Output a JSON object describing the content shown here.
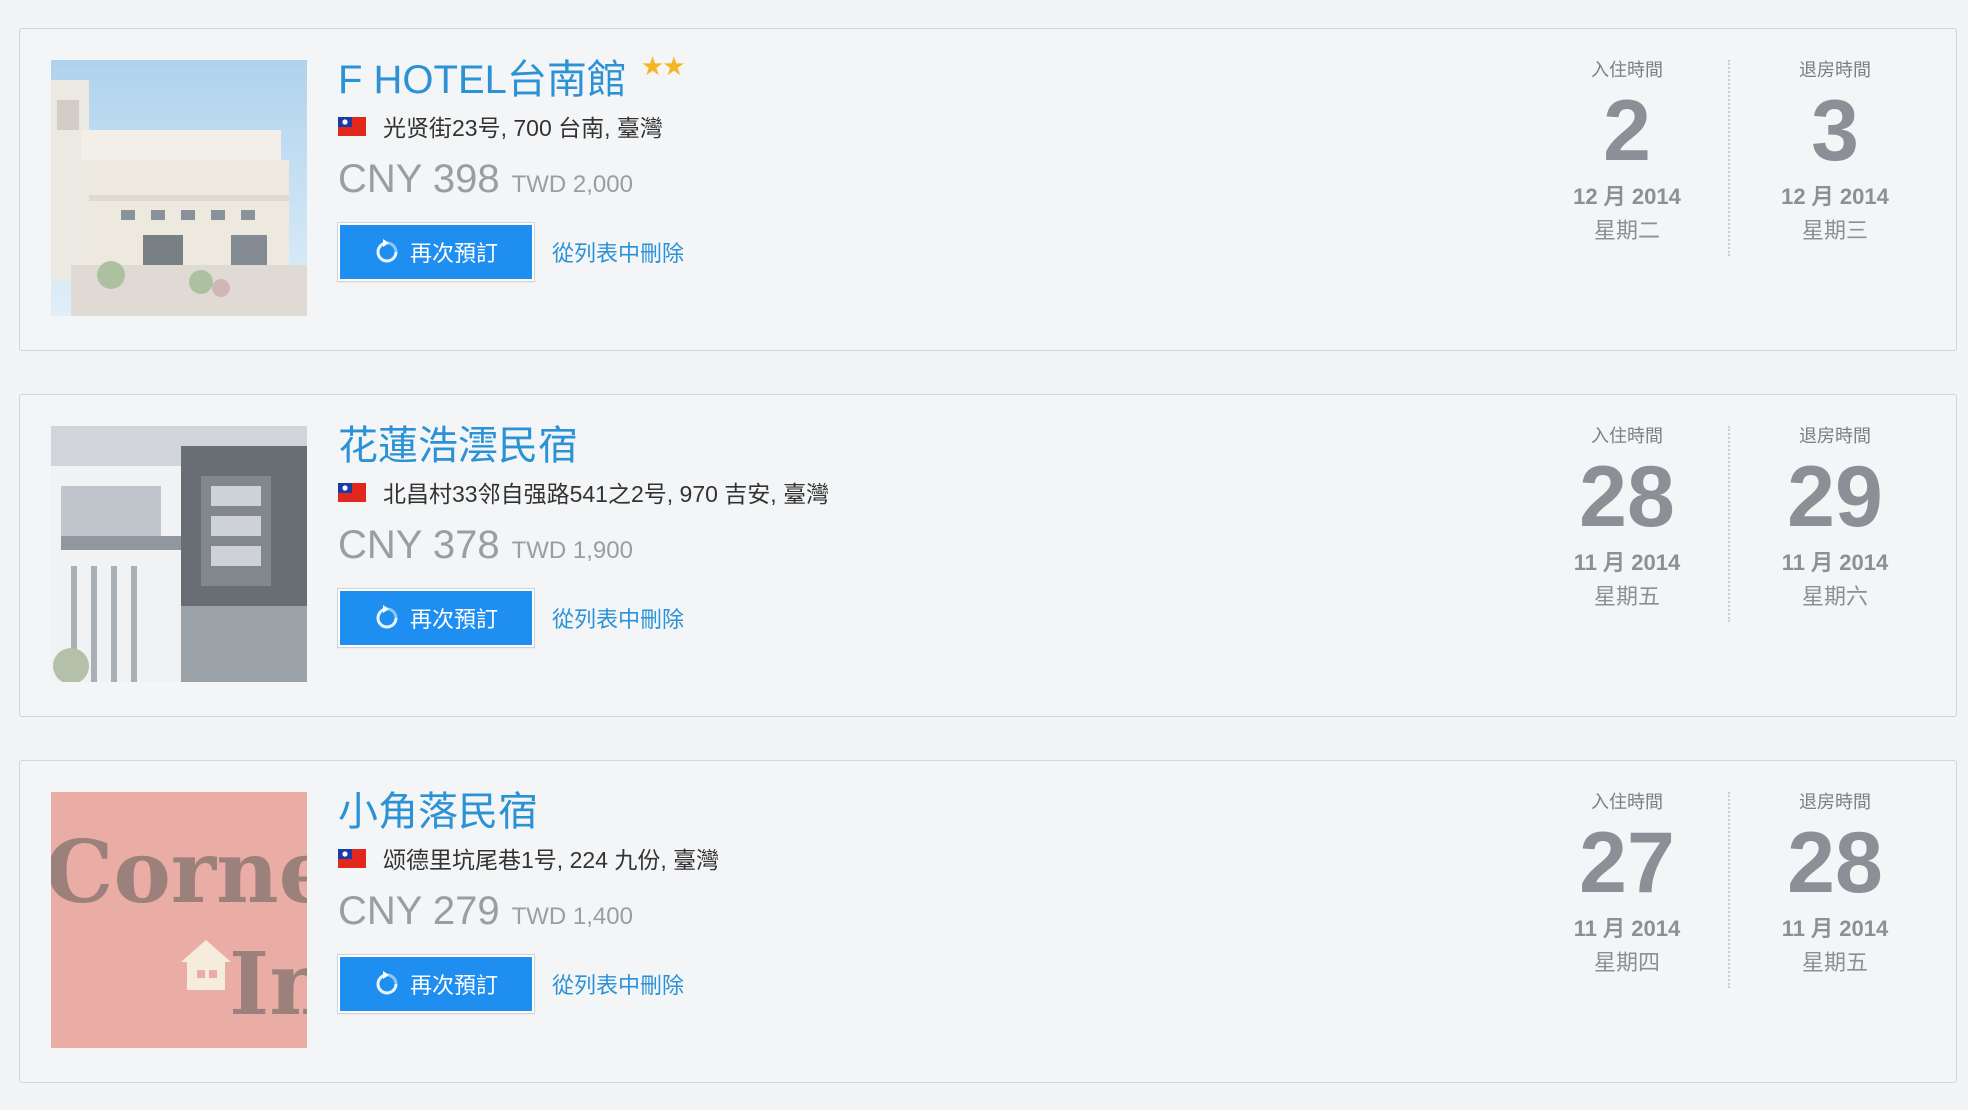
{
  "bookings": [
    {
      "name": "F HOTEL台南館",
      "stars": "★★",
      "address": "光贤街23号, 700 台南, 臺灣",
      "price_main": "CNY 398",
      "price_sub": "TWD 2,000",
      "rebook_label": "再次預訂",
      "remove_label": "從列表中刪除",
      "checkin": {
        "label": "入住時間",
        "day": "2",
        "month": "12 月 2014",
        "weekday": "星期二"
      },
      "checkout": {
        "label": "退房時間",
        "day": "3",
        "month": "12 月 2014",
        "weekday": "星期三"
      }
    },
    {
      "name": "花蓮浩澐民宿",
      "stars": "",
      "address": "北昌村33邻自强路541之2号, 970 吉安, 臺灣",
      "price_main": "CNY 378",
      "price_sub": "TWD 1,900",
      "rebook_label": "再次預訂",
      "remove_label": "從列表中刪除",
      "checkin": {
        "label": "入住時間",
        "day": "28",
        "month": "11 月 2014",
        "weekday": "星期五"
      },
      "checkout": {
        "label": "退房時間",
        "day": "29",
        "month": "11 月 2014",
        "weekday": "星期六"
      }
    },
    {
      "name": "小角落民宿",
      "stars": "",
      "address": "颂德里坑尾巷1号, 224 九份, 臺灣",
      "price_main": "CNY 279",
      "price_sub": "TWD 1,400",
      "rebook_label": "再次預訂",
      "remove_label": "從列表中刪除",
      "checkin": {
        "label": "入住時間",
        "day": "27",
        "month": "11 月 2014",
        "weekday": "星期四"
      },
      "checkout": {
        "label": "退房時間",
        "day": "28",
        "month": "11 月 2014",
        "weekday": "星期五"
      }
    }
  ],
  "thumbnails": [
    {
      "icon": "hotel-building-photo"
    },
    {
      "icon": "guesthouse-building-photo"
    },
    {
      "icon": "corner-inn-sign-photo",
      "sign_text": "Corner Inn"
    }
  ],
  "colors": {
    "link": "#2b92d6",
    "button": "#1e8ff0",
    "star": "#f5b623",
    "muted": "#8c9096"
  }
}
